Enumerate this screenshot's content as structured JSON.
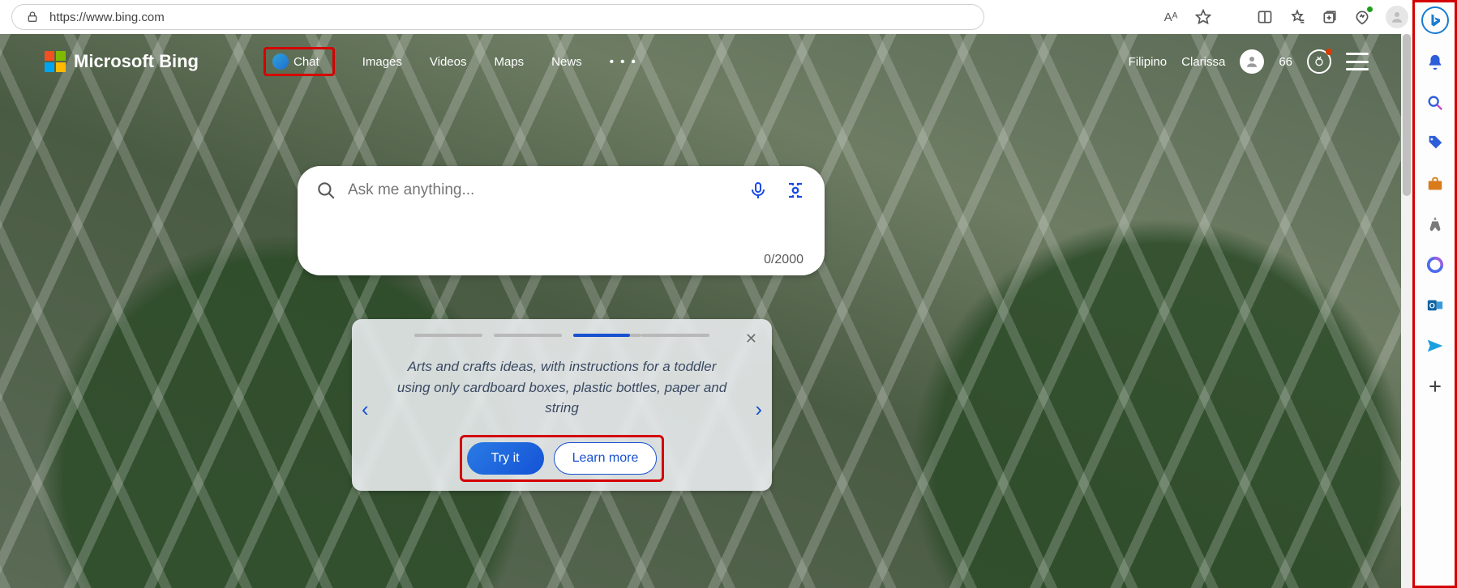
{
  "browser": {
    "url": "https://www.bing.com",
    "actions": {
      "read_aloud": "Aᴬ",
      "more": "⋯"
    }
  },
  "bing": {
    "brand": "Microsoft Bing",
    "nav": {
      "chat": "Chat",
      "images": "Images",
      "videos": "Videos",
      "maps": "Maps",
      "news": "News",
      "more": "• • •"
    },
    "user": {
      "language": "Filipino",
      "name": "Clarissa",
      "points": "66"
    }
  },
  "search": {
    "placeholder": "Ask me anything...",
    "value": "",
    "char_count": "0/2000"
  },
  "carousel": {
    "active_index": 2,
    "total_slides": 4,
    "text": "Arts and crafts ideas, with instructions for a toddler using only cardboard boxes, plastic bottles, paper and string",
    "try_label": "Try it",
    "learn_label": "Learn more"
  },
  "sidebar_icons": [
    "bing",
    "bell",
    "search",
    "tag",
    "briefcase",
    "games",
    "m365",
    "outlook",
    "send",
    "plus"
  ]
}
